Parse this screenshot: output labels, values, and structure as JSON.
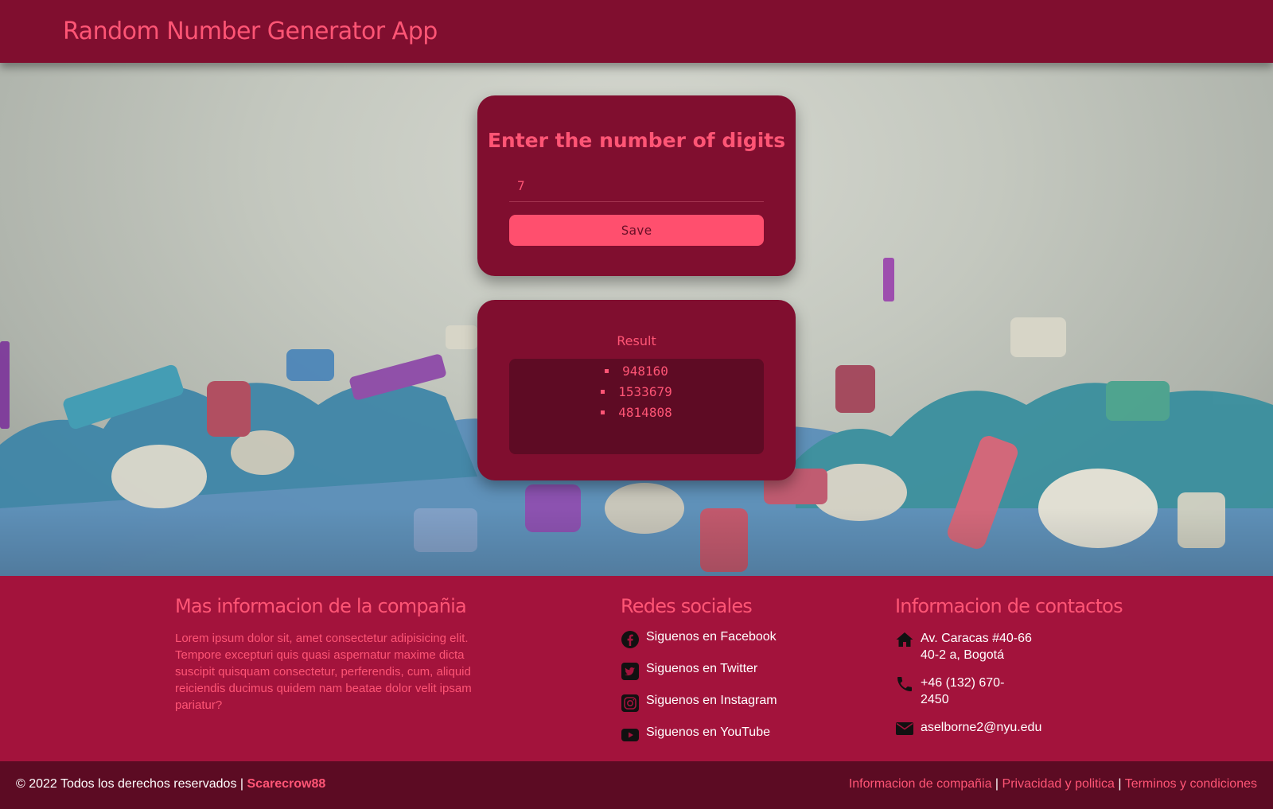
{
  "header": {
    "title": "Random Number Generator App"
  },
  "form": {
    "title": "Enter the number of digits",
    "input_value": "7",
    "save_label": "Save"
  },
  "result": {
    "label": "Result",
    "items": [
      "948160",
      "1533679",
      "4814808"
    ]
  },
  "footer": {
    "about": {
      "heading": "Mas informacion de la compañia",
      "text": "Lorem ipsum dolor sit, amet consectetur adipisicing elit. Tempore excepturi quis quasi aspernatur maxime dicta suscipit quisquam consectetur, perferendis, cum, aliquid reiciendis ducimus quidem nam beatae dolor velit ipsam pariatur?"
    },
    "social": {
      "heading": "Redes sociales",
      "items": [
        {
          "label": "Siguenos en Facebook",
          "icon": "facebook-icon"
        },
        {
          "label": "Siguenos en Twitter",
          "icon": "twitter-icon"
        },
        {
          "label": "Siguenos en Instagram",
          "icon": "instagram-icon"
        },
        {
          "label": "Siguenos en YouTube",
          "icon": "youtube-icon"
        }
      ]
    },
    "contact": {
      "heading": "Informacion de contactos",
      "address_line1": "Av. Caracas #40-66",
      "address_line2": "40-2 a, Bogotá",
      "phone_line1": "+46 (132) 670-",
      "phone_line2": "2450",
      "email": "aselborne2@nyu.edu"
    },
    "bottom": {
      "copyright": "© 2022 Todos los derechos reservados |",
      "brand": "Scarecrow88",
      "links": [
        "Informacion de compañia",
        "Privacidad y politica",
        "Terminos y condiciones"
      ],
      "separator": "|"
    }
  },
  "colors": {
    "header_bg": "#800e2f",
    "accent": "#ff5575",
    "footer_bg": "#a3133c",
    "footer_bottom_bg": "#5c0b23"
  }
}
